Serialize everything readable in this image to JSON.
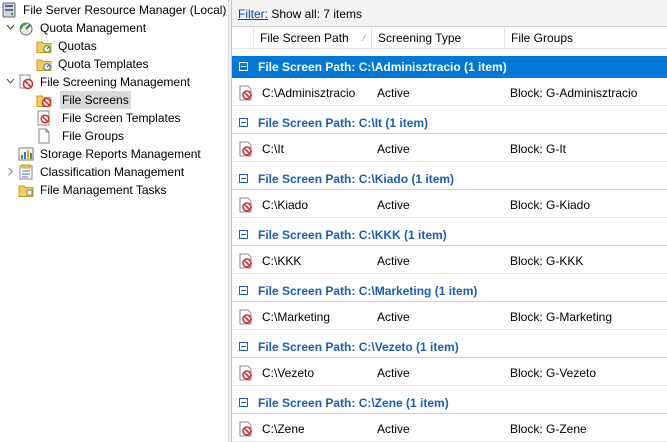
{
  "tree": {
    "items": [
      {
        "label": "File Server Resource Manager (Local)",
        "icon": "server-icon"
      },
      {
        "label": "Quota Management",
        "icon": "quota-icon"
      },
      {
        "label": "Quotas",
        "icon": "quota-folder-icon"
      },
      {
        "label": "Quota Templates",
        "icon": "quota-template-icon"
      },
      {
        "label": "File Screening Management",
        "icon": "file-screen-icon"
      },
      {
        "label": "File Screens",
        "icon": "file-screen-icon"
      },
      {
        "label": "File Screen Templates",
        "icon": "file-screen-template-icon"
      },
      {
        "label": "File Groups",
        "icon": "file-group-icon"
      },
      {
        "label": "Storage Reports Management",
        "icon": "report-icon"
      },
      {
        "label": "Classification Management",
        "icon": "classification-icon"
      },
      {
        "label": "File Management Tasks",
        "icon": "task-folder-icon"
      }
    ],
    "selected": "File Screens"
  },
  "filter": {
    "link": "Filter:",
    "text": " Show all: 7 items"
  },
  "columns": [
    "File Screen Path",
    "Screening Type",
    "File Groups"
  ],
  "groups": [
    {
      "title": "File Screen Path: C:\\Adminisztracio (1 item)",
      "path": "C:\\Adminisztracio",
      "type": "Active",
      "groups": "Block: G-Adminisztracio"
    },
    {
      "title": "File Screen Path: C:\\It (1 item)",
      "path": "C:\\It",
      "type": "Active",
      "groups": "Block: G-It"
    },
    {
      "title": "File Screen Path: C:\\Kiado (1 item)",
      "path": "C:\\Kiado",
      "type": "Active",
      "groups": "Block: G-Kiado"
    },
    {
      "title": "File Screen Path: C:\\KKK (1 item)",
      "path": "C:\\KKK",
      "type": "Active",
      "groups": "Block: G-KKK"
    },
    {
      "title": "File Screen Path: C:\\Marketing (1 item)",
      "path": "C:\\Marketing",
      "type": "Active",
      "groups": "Block: G-Marketing"
    },
    {
      "title": "File Screen Path: C:\\Vezeto (1 item)",
      "path": "C:\\Vezeto",
      "type": "Active",
      "groups": "Block: G-Vezeto"
    },
    {
      "title": "File Screen Path: C:\\Zene (1 item)",
      "path": "C:\\Zene",
      "type": "Active",
      "groups": "Block: G-Zene"
    }
  ],
  "colors": {
    "selection": "#0078d7",
    "group_text": "#1a5fb4",
    "block": "#d62b2b"
  }
}
